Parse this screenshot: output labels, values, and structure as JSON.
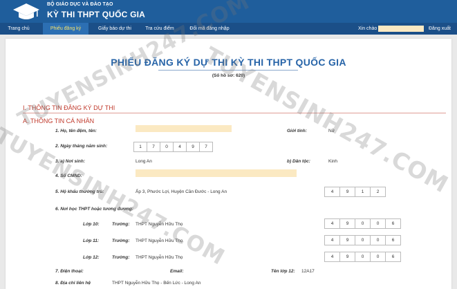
{
  "header": {
    "ministry": "BỘ GIÁO DỤC VÀ ĐÀO TẠO",
    "exam_name": "KỲ THI THPT QUỐC GIA",
    "logo_icon": "graduation-cap-icon",
    "bg_color": "#1f5e9c"
  },
  "nav": {
    "items": [
      {
        "label": "Trang chủ"
      },
      {
        "label": "Phiếu đăng ký",
        "active": true
      },
      {
        "label": "Giấy báo dự thi"
      },
      {
        "label": "Tra cứu điểm"
      },
      {
        "label": "Đổi mã đăng nhập"
      }
    ],
    "greeting": "Xin chào",
    "logout": "Đăng xuất"
  },
  "form": {
    "title": "PHIẾU ĐĂNG KÝ DỰ THI KỲ THI THPT QUỐC GIA",
    "file_no": "(Số hồ sơ: 620)",
    "section1": "I. THÔNG TIN ĐĂNG KÝ DỰ THI",
    "sectionA": "A. THÔNG TIN CÁ NHÂN",
    "fields": {
      "name_label": "1. Họ, tên đệm, tên:",
      "gender_label": "Giới tính:",
      "gender_value": "Nữ",
      "dob_label": "2. Ngày tháng năm sinh:",
      "dob_digits": [
        "1",
        "7",
        "0",
        "4",
        "9",
        "7"
      ],
      "birthplace_label": "3. a) Nơi sinh:",
      "birthplace_value": "Long An",
      "ethnicity_label": "b) Dân tộc:",
      "ethnicity_value": "Kinh",
      "id_label": "4. Số CMND:",
      "residence_label": "5. Hộ khẩu thường trú:",
      "residence_value": "Ấp 3, Phước Lợi, Huyện Cần Đước - Long An",
      "residence_digits": [
        "4",
        "9",
        "1",
        "2"
      ],
      "school_label": "6. Nơi học THPT hoặc tương đương:",
      "school_rows": [
        {
          "grade": "Lớp 10:",
          "school_label": "Trường:",
          "school": "THPT Nguyễn Hữu Thọ",
          "digits": [
            "4",
            "9",
            "0",
            "0",
            "6"
          ]
        },
        {
          "grade": "Lớp 11:",
          "school_label": "Trường:",
          "school": "THPT Nguyễn Hữu Thọ",
          "digits": [
            "4",
            "9",
            "0",
            "0",
            "6"
          ]
        },
        {
          "grade": "Lớp 12:",
          "school_label": "Trường:",
          "school": "THPT Nguyễn Hữu Thọ",
          "digits": [
            "4",
            "9",
            "0",
            "0",
            "6"
          ]
        }
      ],
      "phone_label": "7. Điện thoại:",
      "email_label": "Email:",
      "class12_label": "Tên lớp 12:",
      "class12_value": "12A17",
      "address_label": "8. Địa chỉ liên hệ",
      "address_value": "THPT Nguyễn Hữu Thọ - Bến Lức - Long An"
    }
  },
  "watermark": {
    "text1": "TUYENSINH247.COM",
    "text2": "TUYENSINH247.COM",
    "text3": "TUYENSINH247.COM"
  }
}
